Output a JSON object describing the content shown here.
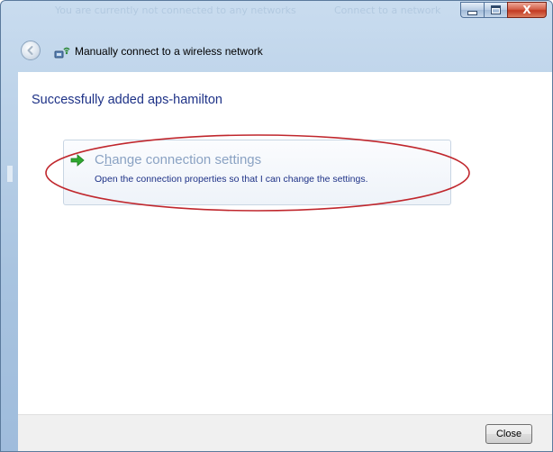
{
  "window": {
    "ghost_title": "You are currently not connected to any networks",
    "ghost_title_right": "Connect to a network",
    "minimize_label": "",
    "maximize_label": "",
    "close_label": "X"
  },
  "nav": {
    "title": "Manually connect to a wireless network",
    "back_icon": "back-arrow-icon",
    "app_icon": "wireless-network-icon"
  },
  "content": {
    "heading": "Successfully added aps-hamilton",
    "command_link": {
      "title_prefix": "C",
      "title_underlined": "h",
      "title_rest": "ange connection settings",
      "description": "Open the connection properties so that I can change the settings.",
      "icon": "green-arrow-icon"
    }
  },
  "footer": {
    "close_button": "Close"
  },
  "colors": {
    "heading": "#1e3287",
    "link_title": "#8aa2c3",
    "annotation": "#c0272d",
    "arrow": "#2fa82f"
  }
}
